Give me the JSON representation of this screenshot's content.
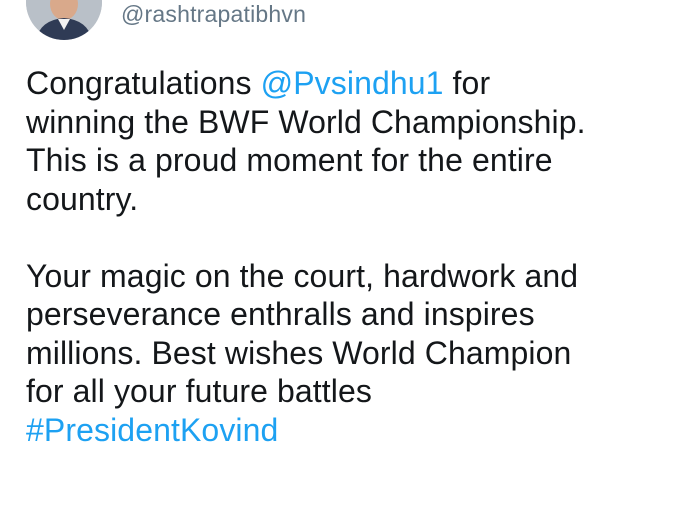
{
  "tweet": {
    "author": {
      "handle": "@rashtrapatibhvn"
    },
    "paragraph1": {
      "before_mention": "Congratulations ",
      "mention": "@Pvsindhu1",
      "after_mention": " for",
      "line2": "winning the BWF World Championship.",
      "line3": "This is a proud moment for the entire",
      "line4": "country."
    },
    "paragraph2": {
      "line1": "Your magic on the court, hardwork and",
      "line2": "perseverance enthralls and inspires",
      "line3": "millions. Best wishes World Champion",
      "line4": "for all your future battles",
      "hashtag": "#PresidentKovind"
    }
  },
  "colors": {
    "text": "#14171a",
    "secondary_text": "#657786",
    "link": "#1da1f2",
    "background": "#ffffff"
  }
}
